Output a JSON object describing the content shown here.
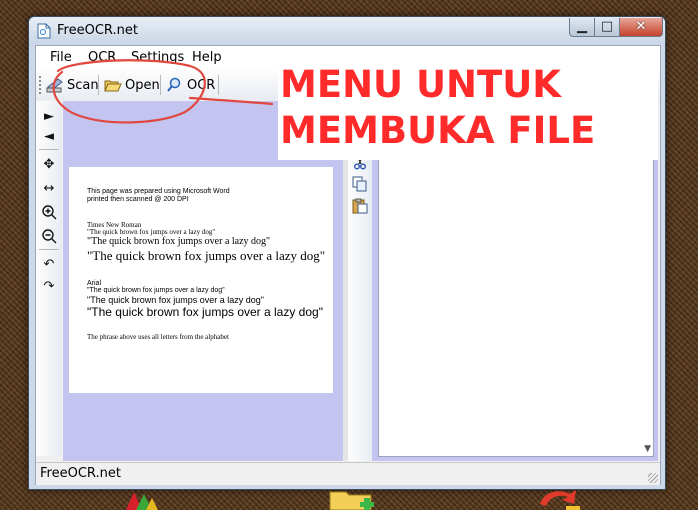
{
  "window": {
    "title": "FreeOCR.net"
  },
  "menu": [
    "File",
    "OCR",
    "Settings",
    "Help"
  ],
  "toolbar": {
    "scan": "Scan",
    "open": "Open",
    "ocr": "OCR"
  },
  "document": {
    "lines": [
      "This page was prepared using Microsoft Word",
      "printed then scanned @ 200 DPI",
      "Times New Roman",
      "\"The quick brown fox jumps over a lazy dog\"",
      "\"The quick brown fox jumps over a lazy dog\"",
      "\"The quick brown fox jumps over a lazy dog\"",
      "Arial",
      "\"The quick brown fox jumps over a lazy dog\"",
      "\"The quick brown fox  jumps over a lazy dog\"",
      "\"The quick brown fox jumps over a lazy dog\"",
      "The phrase above uses all letters from the alphabet"
    ]
  },
  "status": {
    "text": "FreeOCR.net"
  },
  "annotation": {
    "line1": "MENU UNTUK",
    "line2": "MEMBUKA FILE",
    "color": "#ff2a2a"
  },
  "icons": {
    "app": "document-icon",
    "scan": "scanner-icon",
    "open": "folder-open-icon",
    "ocr": "magnifier-icon",
    "side": [
      "arrow-right-icon",
      "arrow-left-icon",
      "move-icon",
      "fit-width-icon",
      "zoom-in-icon",
      "zoom-out-icon",
      "rotate-left-icon",
      "rotate-right-icon"
    ],
    "mid": [
      "cut-icon",
      "copy-icon",
      "paste-icon"
    ]
  }
}
